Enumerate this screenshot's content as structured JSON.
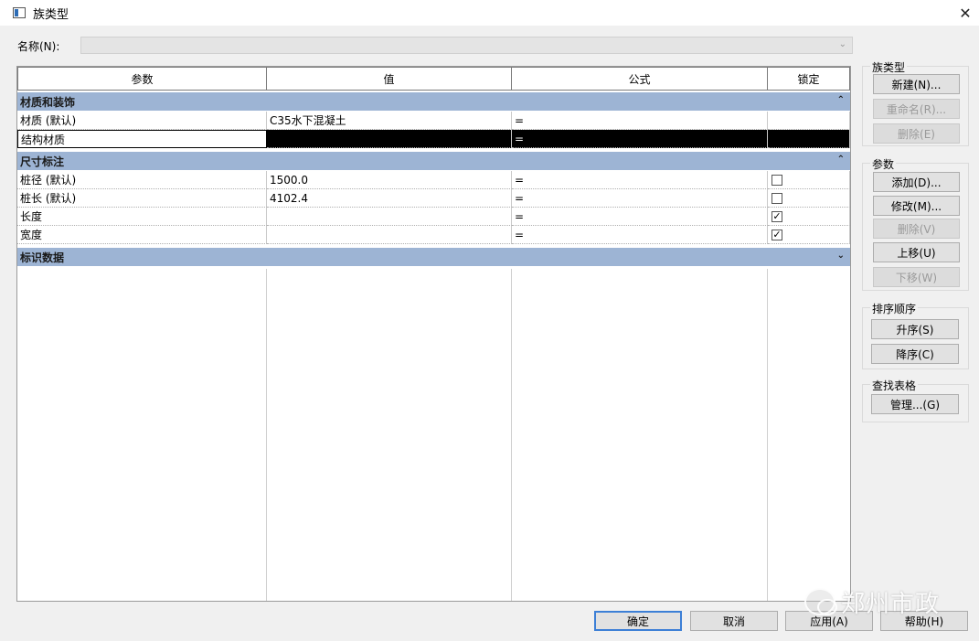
{
  "window": {
    "title": "族类型",
    "close_glyph": "✕"
  },
  "name_field": {
    "label": "名称(N):",
    "value": ""
  },
  "table": {
    "headers": [
      "参数",
      "值",
      "公式",
      "锁定"
    ],
    "groups": [
      {
        "title": "材质和装饰",
        "collapse_glyph": "⌃",
        "rows": [
          {
            "param": "材质 (默认)",
            "value": "C35水下混凝土",
            "formula": "=",
            "lock": null
          },
          {
            "param": "结构材质",
            "value": "",
            "formula": "=",
            "lock": null
          }
        ]
      },
      {
        "title": "尺寸标注",
        "collapse_glyph": "⌃",
        "rows": [
          {
            "param": "桩径 (默认)",
            "value": "1500.0",
            "formula": "=",
            "lock": false
          },
          {
            "param": "桩长 (默认)",
            "value": "4102.4",
            "formula": "=",
            "lock": false
          },
          {
            "param": "长度",
            "value": "",
            "formula": "=",
            "lock": true
          },
          {
            "param": "宽度",
            "value": "",
            "formula": "=",
            "lock": true
          }
        ]
      },
      {
        "title": "标识数据",
        "collapse_glyph": "⌄",
        "rows": []
      }
    ]
  },
  "family_types": {
    "legend": "族类型",
    "new": "新建(N)...",
    "rename": "重命名(R)...",
    "delete": "删除(E)"
  },
  "parameters": {
    "legend": "参数",
    "add": "添加(D)...",
    "modify": "修改(M)...",
    "delete": "删除(V)",
    "move_up": "上移(U)",
    "move_down": "下移(W)"
  },
  "sort_order": {
    "legend": "排序顺序",
    "ascending": "升序(S)",
    "descending": "降序(C)"
  },
  "lookup_tables": {
    "legend": "查找表格",
    "manage": "管理...(G)"
  },
  "footer": {
    "ok": "确定",
    "cancel": "取消",
    "apply": "应用(A)",
    "help": "帮助(H)"
  },
  "watermark": {
    "text": "郑州市政"
  },
  "colors": {
    "group_header": "#9db4d4",
    "selection": "#000000",
    "default_button_border": "#3c7fd6"
  }
}
